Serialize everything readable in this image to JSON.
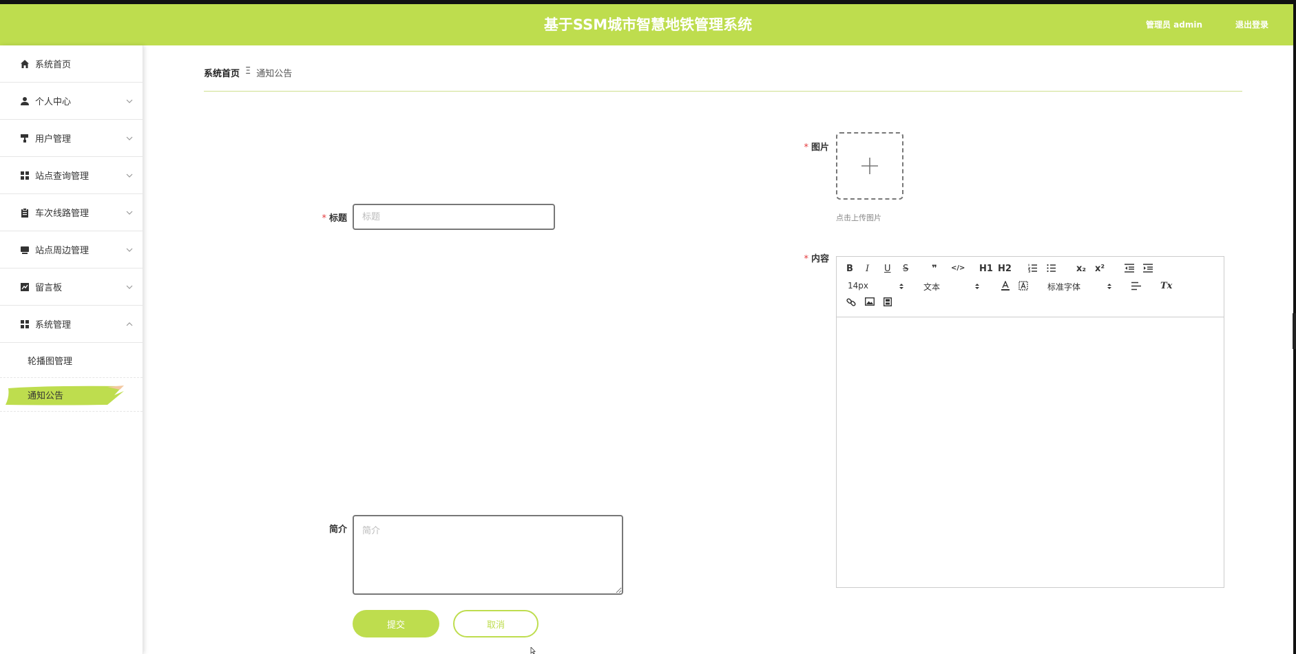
{
  "header": {
    "title": "基于SSM城市智慧地铁管理系统",
    "user": "管理员 admin",
    "logout": "退出登录"
  },
  "sidebar": {
    "items": [
      {
        "label": "系统首页",
        "icon": "home-icon",
        "has_chevron": false
      },
      {
        "label": "个人中心",
        "icon": "user-icon",
        "has_chevron": true
      },
      {
        "label": "用户管理",
        "icon": "paint-roller-icon",
        "has_chevron": true
      },
      {
        "label": "站点查询管理",
        "icon": "grid-icon",
        "has_chevron": true
      },
      {
        "label": "车次线路管理",
        "icon": "clipboard-icon",
        "has_chevron": true
      },
      {
        "label": "站点周边管理",
        "icon": "monitor-icon",
        "has_chevron": true
      },
      {
        "label": "留言板",
        "icon": "chart-icon",
        "has_chevron": true
      },
      {
        "label": "系统管理",
        "icon": "grid-icon",
        "has_chevron": true,
        "expanded": true
      }
    ],
    "subitems": [
      {
        "label": "轮播图管理",
        "active": false
      },
      {
        "label": "通知公告",
        "active": true
      }
    ]
  },
  "breadcrumb": {
    "home": "系统首页",
    "separator": "Ξ",
    "current": "通知公告"
  },
  "form": {
    "title_label": "标题",
    "title_placeholder": "标题",
    "image_label": "图片",
    "upload_hint": "点击上传图片",
    "content_label": "内容",
    "intro_label": "简介",
    "intro_placeholder": "简介",
    "required_mark": "*",
    "submit": "提交",
    "cancel": "取消"
  },
  "editor": {
    "font_size": "14px",
    "text_type": "文本",
    "font_family": "标准字体",
    "buttons": {
      "bold": "B",
      "italic": "I",
      "underline": "U",
      "strike": "S",
      "quote": "❞",
      "code": "</>",
      "h1": "H1",
      "h2": "H2",
      "subscript": "x₂",
      "superscript": "x²",
      "clear": "Tx"
    }
  },
  "colors": {
    "accent": "#bedd4e",
    "required": "#e4393c"
  }
}
